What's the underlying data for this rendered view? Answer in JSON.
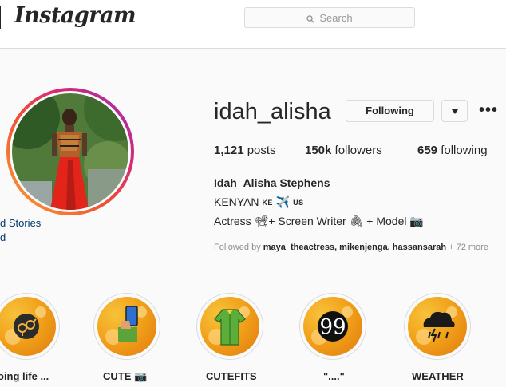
{
  "header": {
    "logo": "Instagram",
    "search": {
      "placeholder": "Search"
    }
  },
  "left_fragment": {
    "line1": "d Stories",
    "line2": "d"
  },
  "profile": {
    "username": "idah_alisha",
    "follow_button": "Following",
    "more": "•••",
    "stats": {
      "posts_count": "1,121",
      "posts_label": "posts",
      "followers_count": "150k",
      "followers_label": "followers",
      "following_count": "659",
      "following_label": "following"
    },
    "full_name": "Idah_Alisha Stephens",
    "bio": {
      "line1_text": "KENYAN",
      "line1_flag1": "KE",
      "line1_emoji": "✈️",
      "line1_flag2": "US",
      "line2": "Actress 📽+ Screen Writer 🖇 + Model 📷"
    },
    "followed_by": {
      "prefix": "Followed by",
      "names": "maya_theactress, mikenjenga, hassansarah",
      "suffix": "+ 72 more"
    }
  },
  "highlights": [
    {
      "label": "oing life ...",
      "icon": "gender-symbols-icon"
    },
    {
      "label": "CUTE 📷",
      "icon": "phone-hand-icon"
    },
    {
      "label": "CUTEFITS",
      "icon": "dress-icon"
    },
    {
      "label": "\"....\"",
      "icon": "quote-icon"
    },
    {
      "label": "WEATHER",
      "icon": "storm-cloud-icon"
    }
  ]
}
